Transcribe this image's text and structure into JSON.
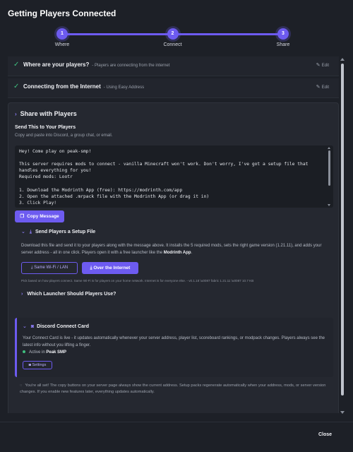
{
  "dialog": {
    "title": "Getting Players Connected",
    "close_label": "Close"
  },
  "stepper": {
    "steps": [
      {
        "number": "1",
        "label": "Where"
      },
      {
        "number": "2",
        "label": "Connect"
      },
      {
        "number": "3",
        "label": "Share"
      }
    ],
    "accent": "#6d5bf0"
  },
  "completed": [
    {
      "title": "Where are your players?",
      "subtitle": "- Players are connecting from the internet",
      "edit_label": "Edit"
    },
    {
      "title": "Connecting from the Internet",
      "subtitle": "- Using Easy Address",
      "edit_label": "Edit"
    }
  ],
  "share": {
    "header": "Share with Players",
    "send_title": "Send This to Your Players",
    "send_sub": "Copy and paste into Discord, a group chat, or email.",
    "message": "Hey! Come play on peak-smp!\n\nThis server requires mods to connect - vanilla Minecraft won't work. Don't worry, I've got a setup file that handles everything for you!\nRequired mods: Lootr\n\n1. Download the Modrinth App (free): https://modrinth.com/app\n2. Open the attached .mrpack file with the Modrinth App (or drag it in)\n3. Click Play!",
    "copy_label": "Copy Message"
  },
  "setup": {
    "title": "Send Players a Setup File",
    "desc_before": "Download this file and send it to your players along with the message above. It installs the 5 required mods, sets the right game version (1.21.11), and adds your server address - all in one click. Players open it with a free launcher like the ",
    "desc_bold": "Modrinth App",
    "desc_after": ".",
    "wifi_label": "Same Wi-Fi / LAN",
    "internet_label": "Over the Internet",
    "pick_note": "Pick based on how players connect. Same Wi-Fi is for players on your home network. Internet is for everyone else. - v0.1.18 \\u0087 fabric 1.21.11 \\u0087 10.7 KB",
    "launcher_title": "Which Launcher Should Players Use?"
  },
  "discord": {
    "title": "Discord Connect Card",
    "desc": "Your Connect Card is live - it updates automatically whenever your server address, player list, scoreboard rankings, or modpack changes. Players always see the latest info without you lifting a finger.",
    "active_prefix": "Active in",
    "active_server": "Peak SMP",
    "settings_label": "Settings"
  },
  "final_note": "You're all set! The copy buttons on your server page always show the current address. Setup packs regenerate automatically when your address, mods, or server version changes. If you enable new features later, everything updates automatically."
}
